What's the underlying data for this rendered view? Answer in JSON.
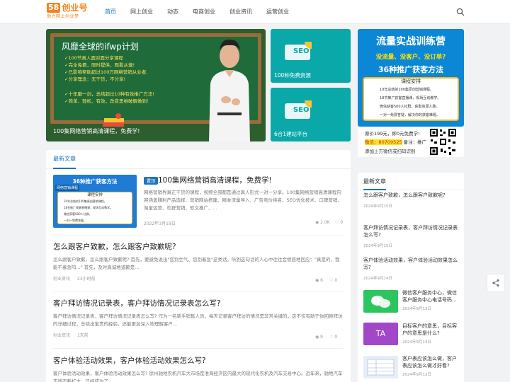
{
  "header": {
    "logo_badge": "58",
    "logo_text": "创业号",
    "logo_slogan": "助力网上创业梦",
    "nav": [
      "首页",
      "网上创业",
      "动态",
      "电商创业",
      "创业资讯",
      "运营创业"
    ],
    "active_nav": "首页",
    "icons": {
      "search": "search-icon"
    }
  },
  "hero": {
    "board_title": "风靡全球的ifwp计划",
    "board_lines": [
      "✓100节真人面对面分享课程",
      "✓完全免费，限时提供，观看从速!",
      "✓已影响帮助超过100万网络营销从业者.",
      "✓分享理念：无干货，不分享!",
      "✓十年磨一剑，总结超过10种有效推广方法!",
      "✓简单、轻松、有效，改变思维破解做到!"
    ],
    "caption": "100集网络营销高清课程，免费学!"
  },
  "tiles": [
    {
      "caption": "100种免费资源",
      "badge": "SEO"
    },
    {
      "caption": "6合1建站平台",
      "badge": "SEO"
    }
  ],
  "promo": {
    "title": "流量实战训练营",
    "sub1": "没流量、没客户、没订单?",
    "sub2": "36种推广获客方法",
    "box_title": "课程安排",
    "box_lines": [
      "10年总结的100集原创营销课程。",
      "18节推广获客直播课，现场互动教学。",
      "微信获客500人社群，获取资源人脉。",
      "一对一免费答疑，解决你的获客难题。"
    ]
  },
  "contact": {
    "line1": "原价199元，即0元免费学!",
    "line2_label": "微信：80709525",
    "line2_note": "备注：推广",
    "line3": "添加上方微信或扫码识别"
  },
  "main": {
    "section_title": "最新文章",
    "featured": {
      "tag": "置顶",
      "title": "100集网络营销高清课程，免费学!",
      "excerpt": "网络营销界真正干货的课程，视频全部都是通过真人形式一对一分享。100集网络营销高清课程内容涵盖赚利产品选择、营销网站搭建、精准流量导入、广告竞价排名、SEO优化技术、口碑营销、淘宝运营、社群营销、软文推广、...",
      "date": "2022年3月19日",
      "views": "2.0K",
      "likes": "0",
      "thumb_title": "36种推广获客方法",
      "thumb_tag": "网络营销课程",
      "thumb_box_title": "课程安排",
      "thumb_lines": [
        "10年总结的100集原创营销课程。",
        "18节推广获客直播课，现场互动教学。",
        "微信获客500人社群。",
        "一对一免费答疑。"
      ]
    },
    "posts": [
      {
        "title": "怎么跟客户致歉，怎么跟客户致歉呢?",
        "excerpt": "怎么跟客户致歉，怎么跟客户致歉呢? 首先，要避免说出\"您别生气、您别着急\"这类话。听到这句话的人心中往往会愤怒地回应：\"真是的，我能不着急吗...\" 首先，及时真诚地道歉是...",
        "category": "创业资讯",
        "time": "23小时前",
        "views": "6",
        "likes": "0"
      },
      {
        "title": "客户拜访情况记录表，客户拜访情况记录表怎么写?",
        "excerpt": "客户拜访情况记录表，客户拜访情况记录表怎么写? 作为一名新手销售人员，每天记录客户拜访的情况是非常关键的。这不仅有助于你回顾拜访的详细过程，总结出宝贵的经验，还能更加深入地理解客户...",
        "category": "创业资讯",
        "time": "1天前",
        "views": "9",
        "likes": "0"
      },
      {
        "title": "客户体验活动效果，客户体验活动效果怎么写?",
        "excerpt": "客户体验活动效果，客户体验活动效果怎么写? 徐州驰地农机汽车大市场是淮海经济区内最大的现代化农机及汽车交易中心。近年来，驰地汽车市场不断扩大，已经成为了...",
        "category": "",
        "time": "",
        "views": "",
        "likes": ""
      }
    ]
  },
  "sidebar": {
    "title": "最新文章",
    "text_items": [
      {
        "title": "怎么跟客户致歉，怎么跟客户致歉呢?",
        "date": "2024年9月15日"
      },
      {
        "title": "客户拜访情况记录表，客户拜访情况记录表怎么写?",
        "date": "2024年9月15日"
      },
      {
        "title": "客户体验活动效果，客户体验活动效果怎么写?",
        "date": "2024年9月14日"
      }
    ],
    "image_items": [
      {
        "title": "微信客户服务中心，微信客户服务中心电话号码...",
        "date": "2024年9月13日",
        "badge": ""
      },
      {
        "title": "目标客户的意思，目标客户的意思是什么?",
        "date": "2024年9月13日",
        "badge": "TA"
      },
      {
        "title": "客户表应该怎么做，客户表应该怎么做才好看?",
        "date": "2024年9月12日",
        "badge": ""
      }
    ]
  },
  "share": {
    "icon": "share-icon"
  },
  "colors": {
    "accent": "#1e73be",
    "brand": "#f5821f"
  }
}
